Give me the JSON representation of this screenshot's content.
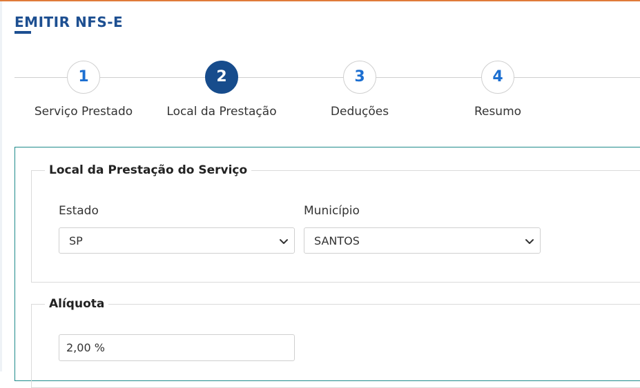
{
  "header": {
    "title": "EMITIR NFS-E"
  },
  "colors": {
    "brand": "#1d4f91",
    "step_active": "#174c8c",
    "step_number": "#1c6fd1",
    "card_border": "#1d8a8a",
    "top_border": "#e07b39"
  },
  "steps": [
    {
      "number": "1",
      "label": "Serviço Prestado",
      "active": false
    },
    {
      "number": "2",
      "label": "Local da Prestação",
      "active": true
    },
    {
      "number": "3",
      "label": "Deduções",
      "active": false
    },
    {
      "number": "4",
      "label": "Resumo",
      "active": false
    }
  ],
  "local_section": {
    "legend": "Local da Prestação do Serviço",
    "estado": {
      "label": "Estado",
      "value": "SP"
    },
    "municipio": {
      "label": "Município",
      "value": "SANTOS"
    }
  },
  "aliquota_section": {
    "legend": "Alíquota",
    "value": "2,00 %"
  },
  "icons": {
    "select_arrow": "chevron-down-icon"
  }
}
